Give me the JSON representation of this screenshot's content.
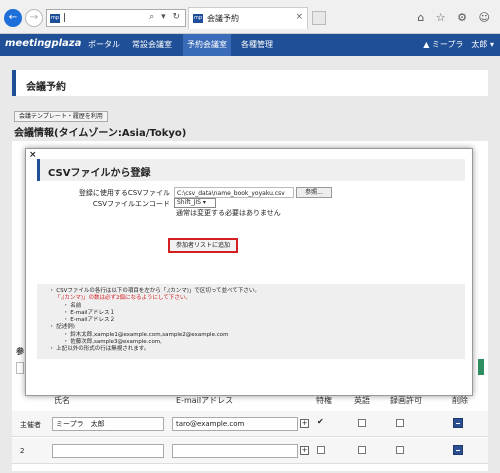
{
  "browser": {
    "address_value": "|",
    "address_icons": "⌕ ▾ ↻",
    "tab_label": "会議予約",
    "favicon_text": "mp",
    "tab_close": "×",
    "win_icons": "⌂ ☆ ⚙ ☺",
    "win_controls": "— ☐ ✕"
  },
  "header": {
    "logo": "meetingplaza",
    "nav": [
      "ポータル",
      "常設会議室",
      "予約会議室",
      "各種管理"
    ],
    "active_nav": 2,
    "user": "▲ ミープラ　太郎 ▾"
  },
  "page": {
    "title": "会議予約",
    "template_button": "会議テンプレート・履歴を利用",
    "info_heading": "会議情報(タイムゾーン:Asia/Tokyo)"
  },
  "modal": {
    "close": "×",
    "title": "CSVファイルから登録",
    "file_label": "登録に使用するCSVファイル",
    "file_path": "C:\\csv_data\\name_book_yoyaku.csv",
    "browse_button": "参照...",
    "encoding_label": "CSVファイルエンコード",
    "encoding_value": "Shift_JIS ▾",
    "encoding_note": "通常は変更する必要はありません",
    "add_button": "参加者リストに追加",
    "instructions": [
      "・ CSVファイルの各行は以下の項目を左から「,(カンマ)」で区切って並べて下さい。",
      "「,(カンマ)」の数は必ず2個になるようにして下さい。",
      "・ 名前",
      "・ E-mailアドレス１",
      "・ E-mailアドレス２",
      "・ 記述例)",
      "・ 鈴木太郎,xample1@example.com,sample2@example.com",
      "・ 佐藤次郎,sample3@example.com,",
      "・ 上記以外の形式の行は無視されます。"
    ]
  },
  "table": {
    "headers": [
      "氏名",
      "E-mailアドレス",
      "特権",
      "英語",
      "録画許可",
      "削除"
    ],
    "rows": [
      {
        "label": "主催者",
        "name": "ミープラ　太郎",
        "email": "taro@example.com",
        "privilege": "✔"
      },
      {
        "label": "2",
        "name": "",
        "email": "",
        "privilege": ""
      }
    ],
    "behind_fragment": "参"
  },
  "colors": {
    "header_blue": "#1f4f96",
    "highlight_red": "#d42020",
    "green_button": "#2d8f5f"
  }
}
